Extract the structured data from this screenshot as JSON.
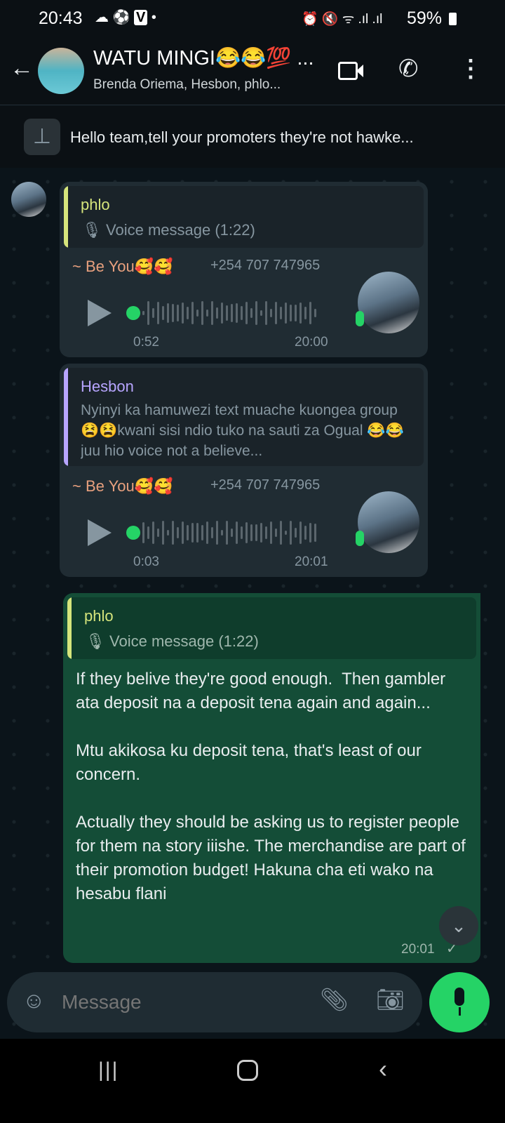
{
  "status_bar": {
    "time": "20:43",
    "battery": "59%",
    "icons": [
      "cloud-icon",
      "soccer-icon",
      "v-app-icon",
      "alarm-icon",
      "mute-icon",
      "wifi-icon",
      "signal-icon",
      "signal-icon",
      "battery-icon"
    ]
  },
  "header": {
    "title": "WATU MINGI😂😂💯 ...",
    "subtitle": "Brenda Oriema, Hesbon, phlo..."
  },
  "pinned": {
    "text": "Hello team,tell your promoters they're not hawke..."
  },
  "messages": [
    {
      "quote_author": "phlo",
      "quote_author_color": "#d6e57c",
      "quote_text": "Voice message (1:22)",
      "sender": "~ Be You🥰🥰",
      "phone": "+254 707 747965",
      "duration": "0:52",
      "time": "20:00"
    },
    {
      "quote_author": "Hesbon",
      "quote_author_color": "#b7a5ff",
      "quote_text": "Nyinyi ka hamuwezi text muache kuongea group 😫😫kwani sisi ndio tuko na sauti za Ogual 😂😂juu hio voice not a believe...",
      "sender": "~ Be You🥰🥰",
      "phone": "+254 707 747965",
      "duration": "0:03",
      "time": "20:01"
    },
    {
      "quote_author": "phlo",
      "quote_text": "Voice message (1:22)",
      "body": "If they belive they're good enough.  Then gambler ata deposit na a deposit tena again and again...\n\nMtu akikosa ku deposit tena, that's least of our concern.\n\nActually they should be asking us to register people for them na story iiishe. The merchandise are part of their promotion budget! Hakuna cha eti wako na hesabu flani",
      "time": "20:01",
      "status": "sent"
    }
  ],
  "composer": {
    "placeholder": "Message"
  },
  "colors": {
    "accent": "#25d366",
    "outgoing": "#144d37",
    "incoming": "#202c33",
    "sender": "#e8a07e"
  }
}
